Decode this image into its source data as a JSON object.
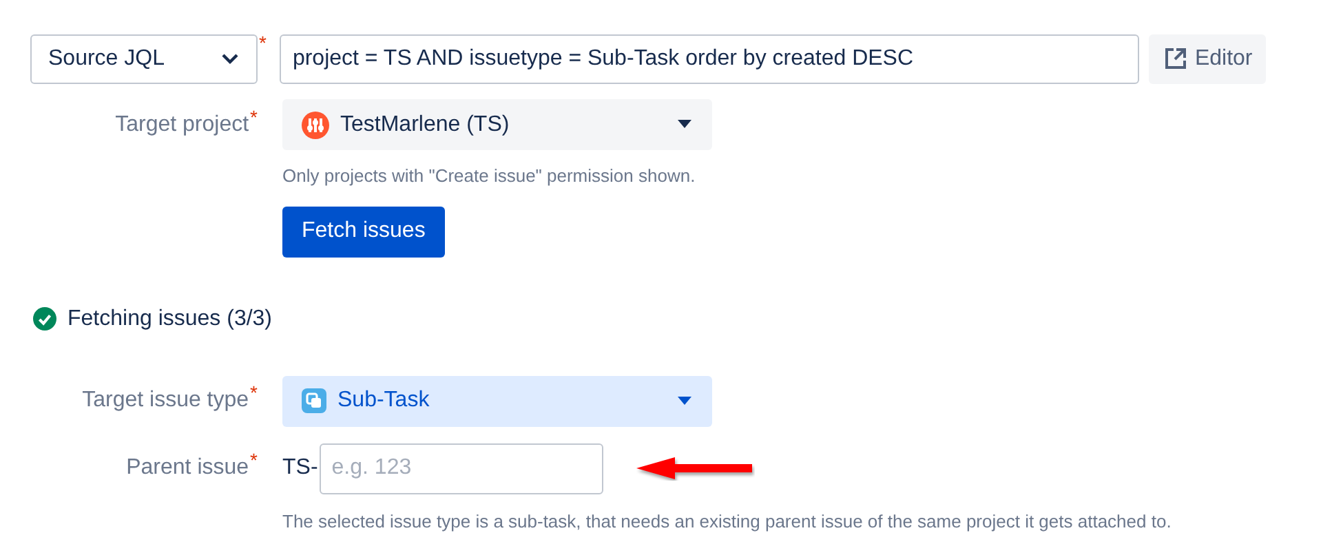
{
  "source": {
    "select": {
      "value": "Source JQL",
      "required_mark": "*"
    },
    "query": {
      "value": "project = TS AND issuetype = Sub-Task order by created DESC"
    },
    "editor_button": {
      "label": "Editor"
    }
  },
  "target_project": {
    "label": "Target project",
    "required_mark": "*",
    "value": "TestMarlene (TS)",
    "help": "Only projects with \"Create issue\" permission shown."
  },
  "fetch_button": {
    "label": "Fetch issues"
  },
  "status": {
    "complete": true,
    "text": "Fetching issues (3/3)"
  },
  "target_issue_type": {
    "label": "Target issue type",
    "required_mark": "*",
    "value": "Sub-Task",
    "highlighted": true
  },
  "parent_issue": {
    "label": "Parent issue",
    "required_mark": "*",
    "prefix": "TS-",
    "placeholder": "e.g. 123",
    "help": "The selected issue type is a sub-task, that needs an existing parent issue of the same project it gets attached to."
  }
}
